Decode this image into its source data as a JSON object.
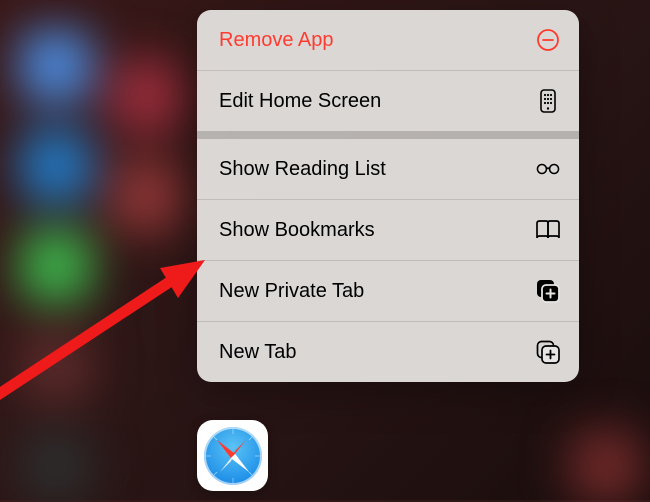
{
  "menu": {
    "remove_app": "Remove App",
    "edit_home_screen": "Edit Home Screen",
    "show_reading_list": "Show Reading List",
    "show_bookmarks": "Show Bookmarks",
    "new_private_tab": "New Private Tab",
    "new_tab": "New Tab"
  },
  "app_label": "Safari",
  "colors": {
    "destructive": "#ff3b30",
    "menu_bg": "rgba(232,230,228,0.93)"
  },
  "annotation": {
    "points_to": "new_private_tab"
  }
}
